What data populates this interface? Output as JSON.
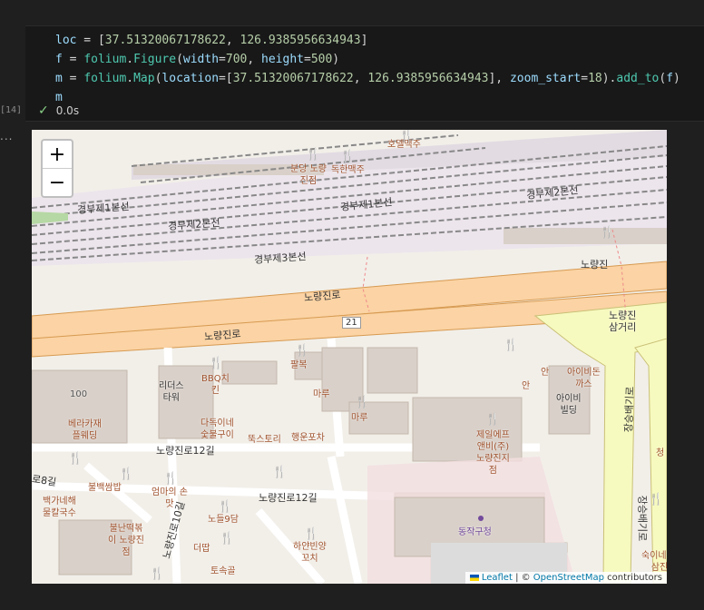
{
  "code_lines": [
    {
      "parts": [
        [
          "var",
          "loc"
        ],
        [
          "op",
          " = ["
        ],
        [
          "num",
          "37.51320067178622"
        ],
        [
          "op",
          ", "
        ],
        [
          "num",
          "126.9385956634943"
        ],
        [
          "op",
          "]"
        ]
      ]
    },
    {
      "parts": [
        [
          "var",
          "f"
        ],
        [
          "op",
          " = "
        ],
        [
          "fn",
          "folium"
        ],
        [
          "op",
          "."
        ],
        [
          "fn",
          "Figure"
        ],
        [
          "op",
          "("
        ],
        [
          "var",
          "width"
        ],
        [
          "op",
          "="
        ],
        [
          "num",
          "700"
        ],
        [
          "op",
          ", "
        ],
        [
          "var",
          "height"
        ],
        [
          "op",
          "="
        ],
        [
          "num",
          "500"
        ],
        [
          "op",
          ")"
        ]
      ]
    },
    {
      "parts": [
        [
          "var",
          "m"
        ],
        [
          "op",
          " = "
        ],
        [
          "fn",
          "folium"
        ],
        [
          "op",
          "."
        ],
        [
          "fn",
          "Map"
        ],
        [
          "op",
          "("
        ],
        [
          "var",
          "location"
        ],
        [
          "op",
          "=["
        ],
        [
          "num",
          "37.51320067178622"
        ],
        [
          "op",
          ", "
        ],
        [
          "num",
          "126.9385956634943"
        ],
        [
          "op",
          "], "
        ],
        [
          "var",
          "zoom_start"
        ],
        [
          "op",
          "="
        ],
        [
          "num",
          "18"
        ],
        [
          "op",
          ")."
        ],
        [
          "fn",
          "add_to"
        ],
        [
          "op",
          "("
        ],
        [
          "var",
          "f"
        ],
        [
          "op",
          ")"
        ]
      ]
    },
    {
      "parts": [
        [
          "var",
          "m"
        ]
      ]
    }
  ],
  "cell": {
    "exec_count": "[14]",
    "status_time": "0.0s",
    "output_marker": "..."
  },
  "map": {
    "zoom_in": "+",
    "zoom_out": "−",
    "attribution_leaflet": "Leaflet",
    "attribution_sep": " | © ",
    "attribution_osm": "OpenStreetMap",
    "attribution_tail": " contributors",
    "labels": {
      "rail1": "경부제1본선",
      "rail2": "경부제2본선",
      "rail3": "경부제3본선",
      "rail4": "경부제1본선",
      "rail5": "경부제2본선",
      "road_upper": "노량진로",
      "road_lower": "노량진로",
      "route_num": "21",
      "road_12gil_a": "노량진로12길",
      "road_12gil_b": "노량진로12길",
      "road_8gil": "로8길",
      "road_10gil": "노량진로10길",
      "road_right1": "장승배기로",
      "road_right2": "장승배기로",
      "noryangjin": "노량진",
      "intersection": "노량진\n삼거리",
      "dongjak": "동작구청",
      "aibilding": "아이비\n빌딩",
      "ridus": "리더스\n타워",
      "b100": "100"
    },
    "pois": {
      "p_top1": "분당 노량\n진점",
      "p_top2": "독한맥주",
      "p_top3": "호델맥주",
      "p_bbq": "BBQ치\n킨",
      "p_palbok": "팔복",
      "p_maru1": "마루",
      "p_maru2": "마루",
      "p_dadok": "다독이네\n숯불구이",
      "p_ttuk": "뚝스토리",
      "p_haengun": "행운포차",
      "p_jeil": "제일에프\n앤비(주)\n노량진지\n점",
      "p_bella": "베라카재\n플웨딩",
      "p_bulbaek": "불백쌈밥",
      "p_baekga": "백가네해\n물칼국수",
      "p_eomma": "엄마의 손\n맛",
      "p_bulnan": "불난떡볶\n이 노량진\n점",
      "p_nodle": "노들9담",
      "p_deopdap": "더땁",
      "p_tosok": "토속골",
      "p_hayan": "하얀빈양\n꼬치",
      "p_aibitton": "아이비돈\n까스",
      "p_an1": "안",
      "p_an2": "안",
      "p_suk": "숙이네 냉\n삼진",
      "p_cheong": "청"
    }
  }
}
